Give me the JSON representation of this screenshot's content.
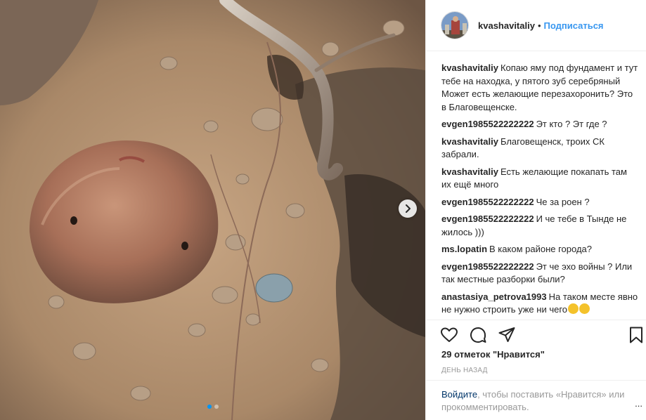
{
  "post": {
    "username": "kvashavitaliy",
    "separator": "•",
    "follow_label": "Подписаться",
    "likes_text": "29 отметок \"Нравится\"",
    "date_text": "ДЕНЬ НАЗАД"
  },
  "comments": [
    {
      "user": "kvashavitaliy",
      "text": "Копаю яму под фундамент и тут тебе на находка, у пятого зуб серебряный\nМожет есть желающие перезахоронить? Это в Благовещенске."
    },
    {
      "user": "evgen1985522222222",
      "text": "Эт кто ? Эт где ?"
    },
    {
      "user": "kvashavitaliy",
      "text": "Благовещенск, троих СК забрали."
    },
    {
      "user": "kvashavitaliy",
      "text": "Есть желающие покапать там их ещё много"
    },
    {
      "user": "evgen1985522222222",
      "text": "Че за роен ?"
    },
    {
      "user": "evgen1985522222222",
      "text": "И че тебе в Тынде не жилось )))"
    },
    {
      "user": "ms.lopatin",
      "text": "В каком районе города?"
    },
    {
      "user": "evgen1985522222222",
      "text": "Эт че эхо войны ? Или так местные разборки были?"
    },
    {
      "user": "anastasiya_petrova1993",
      "text": "На таком месте явно не нужно строить уже ни чего"
    }
  ],
  "login": {
    "link_label": "Войдите",
    "rest_text": ", чтобы поставить «Нравится» или прокомментировать.",
    "more_label": "..."
  },
  "icons": {
    "like": "heart-icon",
    "comment": "comment-bubble-icon",
    "share": "share-plane-icon",
    "save": "bookmark-icon",
    "next": "chevron-right-icon"
  },
  "colors": {
    "follow": "#3897f0",
    "link": "#003569",
    "muted": "#999999",
    "text": "#262626"
  }
}
